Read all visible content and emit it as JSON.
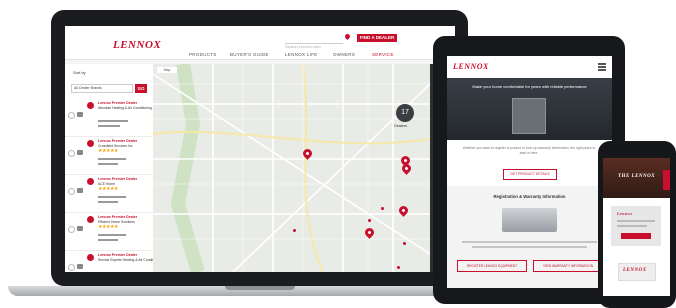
{
  "laptop": {
    "logo": "LENNOX",
    "nav": [
      "PRODUCTS",
      "BUYER'S GUIDE",
      "LENNOX LIFE",
      "OWNERS",
      "SERVICE"
    ],
    "search_placeholder": "Search Lennox.com",
    "find_dealer_label": "FIND A DEALER",
    "left_panel_label": "Sort by",
    "filter_select_value": "All Dealer Brands",
    "filter_go": "GO",
    "dealers": [
      {
        "name": "Lennox Premier Dealer",
        "sub": "Absolute Heating & Air Conditioning",
        "rating": "★★★★★"
      },
      {
        "name": "Lennox Premier Dealer",
        "sub": "Crossfield Services Inc",
        "rating": "★★★★★"
      },
      {
        "name": "Lennox Premier Dealer",
        "sub": "ACE Home",
        "rating": "★★★★★"
      },
      {
        "name": "Lennox Premier Dealer",
        "sub": "Efficient Home Solutions",
        "rating": "★★★★★"
      },
      {
        "name": "Lennox Premier Dealer",
        "sub": "Service Experts Heating & Air Conditioning",
        "rating": ""
      }
    ],
    "results_count": "17",
    "results_label": "Dealers"
  },
  "tablet": {
    "logo": "LENNOX",
    "hero_text": "Make your home comfortable for years with reliable performance",
    "intro_text": "Whether you want to register a product or look up warranty information, the right place to start is here.",
    "get_details_label": "GET PRODUCT DETAILS",
    "section_title": "Registration & Warranty Information",
    "register_label": "REGISTER LENNOX EQUIPMENT",
    "warranty_label": "VIEW WARRANTY INFORMATION"
  },
  "phone": {
    "logo": "LENNOX",
    "hero_text": "THE LENNOX",
    "card_label": "Lennox",
    "bottom_logo": "LENNOX"
  },
  "colors": {
    "brand_red": "#c8102e",
    "device_black": "#1a1c1f",
    "map_land": "#e9ebe6",
    "map_road": "#ffffff",
    "map_park": "#cfe3c4"
  }
}
